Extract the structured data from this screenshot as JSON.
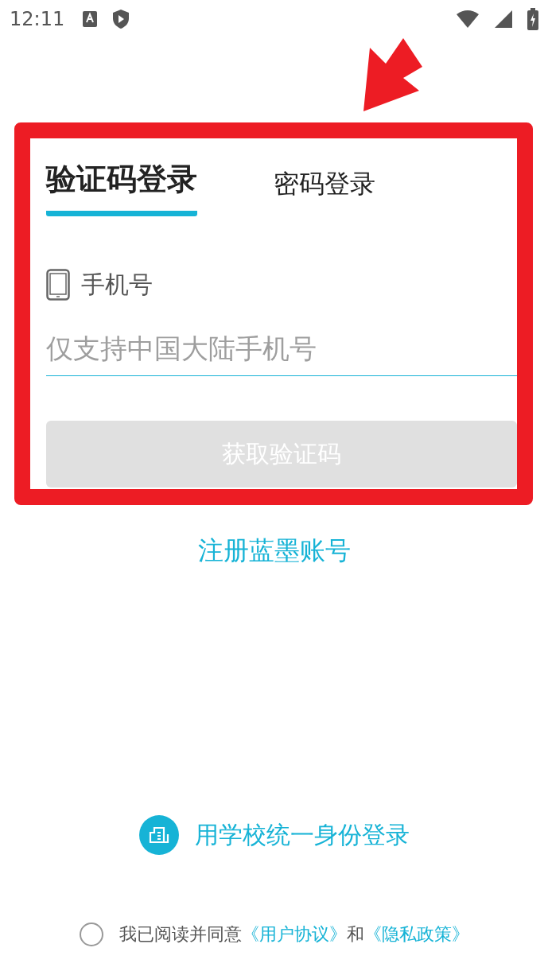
{
  "status_bar": {
    "time": "12:11"
  },
  "tabs": [
    {
      "label": "验证码登录",
      "selected": true
    },
    {
      "label": "密码登录",
      "selected": false
    }
  ],
  "phone_field": {
    "label": "手机号",
    "placeholder": "仅支持中国大陆手机号"
  },
  "get_code_button": {
    "label": "获取验证码",
    "disabled": true
  },
  "register_link": "注册蓝墨账号",
  "school_login": "用学校统一身份登录",
  "agreement": {
    "checked": false,
    "text": "我已阅读并同意",
    "link_1": "《用户协议》",
    "joiner": "和",
    "link_2": "《隐私政策》"
  }
}
